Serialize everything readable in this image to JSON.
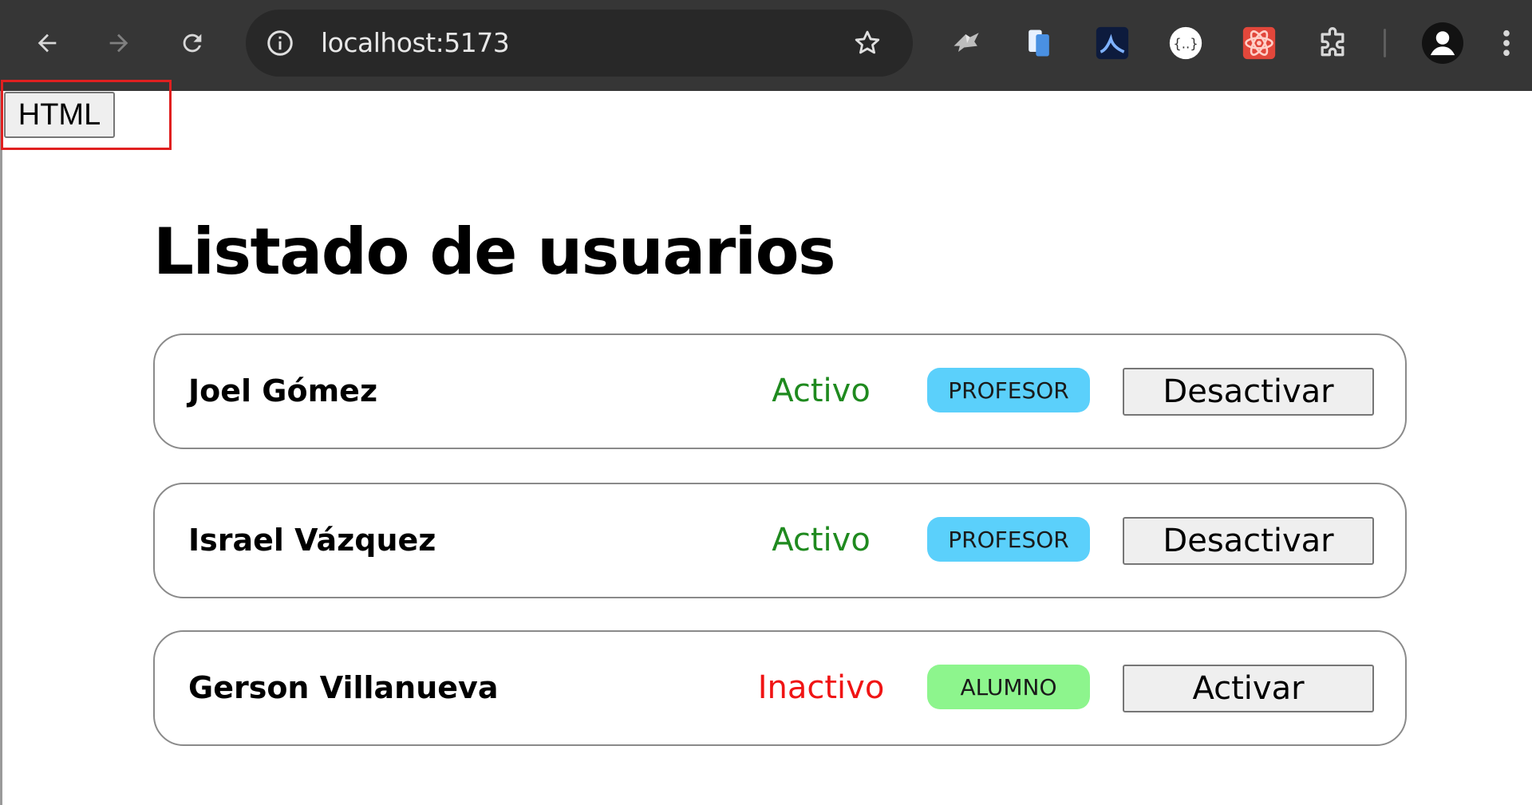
{
  "browser": {
    "url": "localhost:5173",
    "icons": {
      "back": "arrow-left-icon",
      "forward": "arrow-right-icon",
      "reload": "reload-icon",
      "site_info": "info-icon",
      "bookmark": "star-icon",
      "extensions": [
        "bird-extension-icon",
        "mobile-extension-icon",
        "vpn-extension-icon",
        "json-extension-icon",
        "react-devtools-icon",
        "puzzle-extensions-icon"
      ],
      "profile": "profile-avatar-icon",
      "menu": "kebab-menu-icon"
    }
  },
  "page": {
    "html_button_label": "HTML",
    "title": "Listado de usuarios",
    "users": [
      {
        "name": "Joel Gómez",
        "status": "Activo",
        "status_color": "#1f8a1f",
        "role": "PROFESOR",
        "role_color": "#5bd0fb",
        "action": "Desactivar"
      },
      {
        "name": "Israel Vázquez",
        "status": "Activo",
        "status_color": "#1f8a1f",
        "role": "PROFESOR",
        "role_color": "#5bd0fb",
        "action": "Desactivar"
      },
      {
        "name": "Gerson Villanueva",
        "status": "Inactivo",
        "status_color": "#f01414",
        "role": "ALUMNO",
        "role_color": "#8df58d",
        "action": "Activar"
      }
    ]
  }
}
